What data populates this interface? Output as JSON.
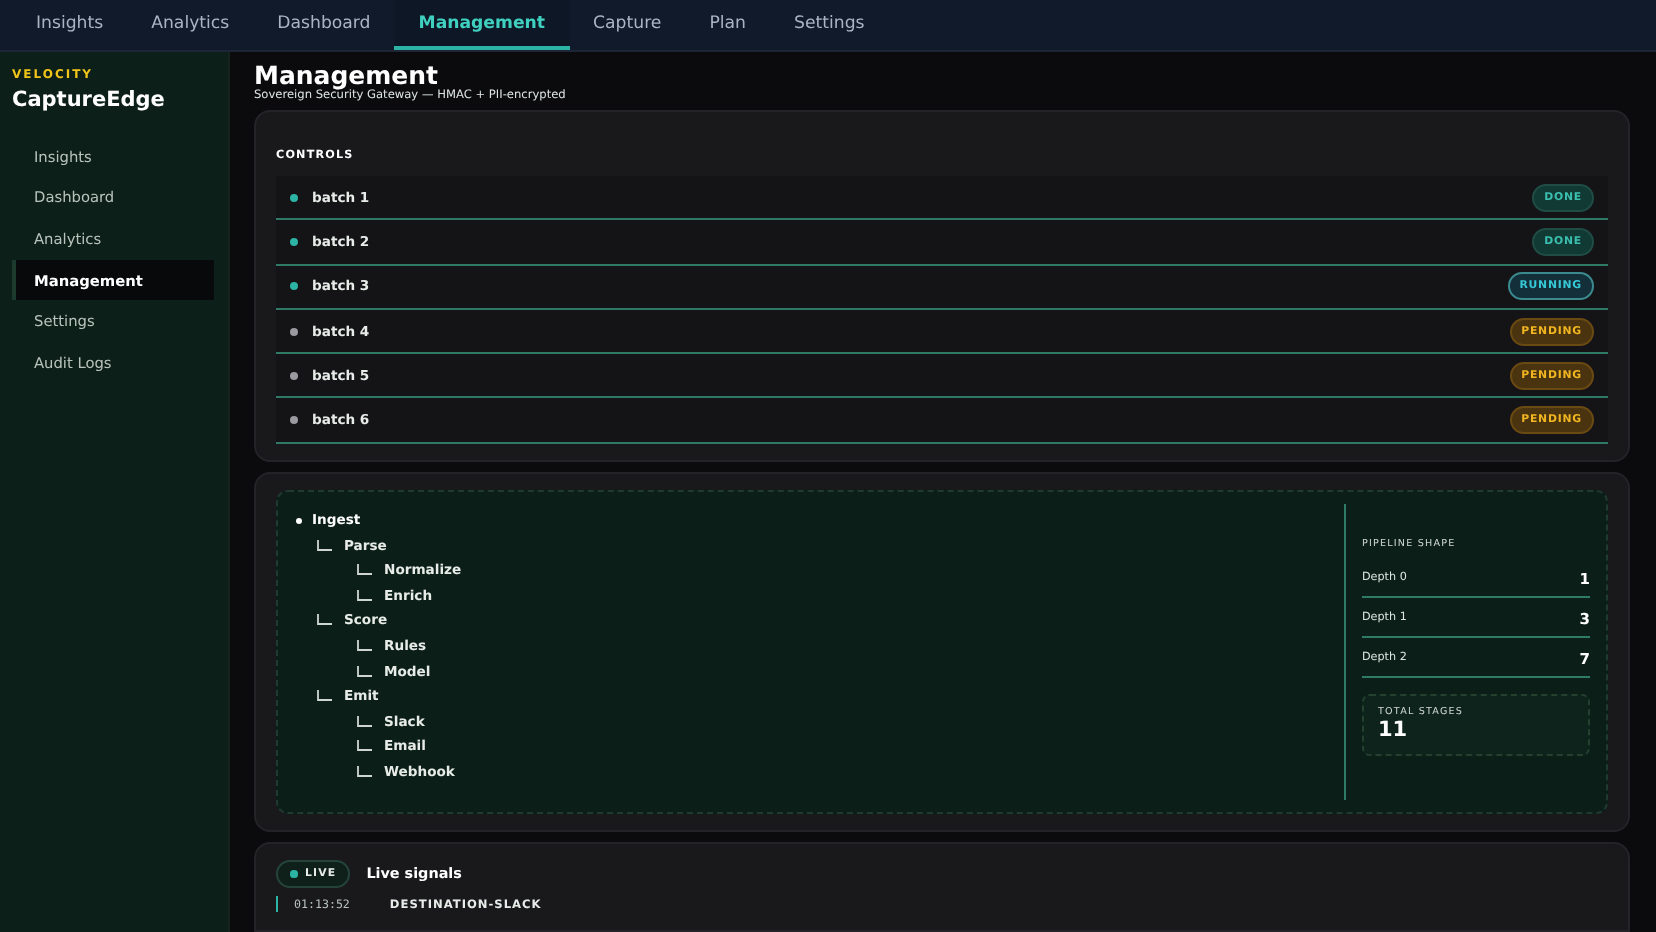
{
  "top_nav": {
    "tabs": [
      {
        "label": "Insights",
        "selected": false
      },
      {
        "label": "Analytics",
        "selected": false
      },
      {
        "label": "Dashboard",
        "selected": false
      },
      {
        "label": "Management",
        "selected": true
      },
      {
        "label": "Capture",
        "selected": false
      },
      {
        "label": "Plan",
        "selected": false
      },
      {
        "label": "Settings",
        "selected": false
      }
    ]
  },
  "sidebar": {
    "brand_tag": "VELOCITY",
    "brand": "CaptureEdge",
    "items": [
      {
        "label": "Insights",
        "selected": false
      },
      {
        "label": "Dashboard",
        "selected": false
      },
      {
        "label": "Analytics",
        "selected": false
      },
      {
        "label": "Management",
        "selected": true
      },
      {
        "label": "Settings",
        "selected": false
      },
      {
        "label": "Audit Logs",
        "selected": false
      }
    ]
  },
  "header": {
    "title": "Management",
    "subtitle": "Sovereign Security Gateway — HMAC + PII-encrypted"
  },
  "controls": {
    "title": "CONTROLS",
    "rows": [
      {
        "name": "batch 1",
        "kind": "done",
        "badge": "DONE"
      },
      {
        "name": "batch 2",
        "kind": "done",
        "badge": "DONE"
      },
      {
        "name": "batch 3",
        "kind": "running",
        "badge": "RUNNING"
      },
      {
        "name": "batch 4",
        "kind": "pending",
        "badge": "PENDING"
      },
      {
        "name": "batch 5",
        "kind": "pending",
        "badge": "PENDING"
      },
      {
        "name": "batch 6",
        "kind": "pending",
        "badge": "PENDING"
      }
    ]
  },
  "pipeline": {
    "tree": [
      {
        "label": "Ingest",
        "children": [
          {
            "label": "Parse",
            "children": [
              {
                "label": "Normalize"
              },
              {
                "label": "Enrich"
              }
            ]
          },
          {
            "label": "Score",
            "children": [
              {
                "label": "Rules"
              },
              {
                "label": "Model"
              }
            ]
          },
          {
            "label": "Emit",
            "children": [
              {
                "label": "Slack"
              },
              {
                "label": "Email"
              },
              {
                "label": "Webhook"
              }
            ]
          }
        ]
      }
    ],
    "shape_title": "PIPELINE SHAPE",
    "depths": [
      {
        "label": "Depth 0",
        "value": "1"
      },
      {
        "label": "Depth 1",
        "value": "3"
      },
      {
        "label": "Depth 2",
        "value": "7"
      }
    ],
    "total": {
      "label": "TOTAL STAGES",
      "value": "11"
    }
  },
  "live": {
    "badge": "LIVE",
    "title": "Live signals",
    "entries": [
      {
        "time": "01:13:52",
        "event": "DESTINATION-SLACK"
      }
    ]
  }
}
